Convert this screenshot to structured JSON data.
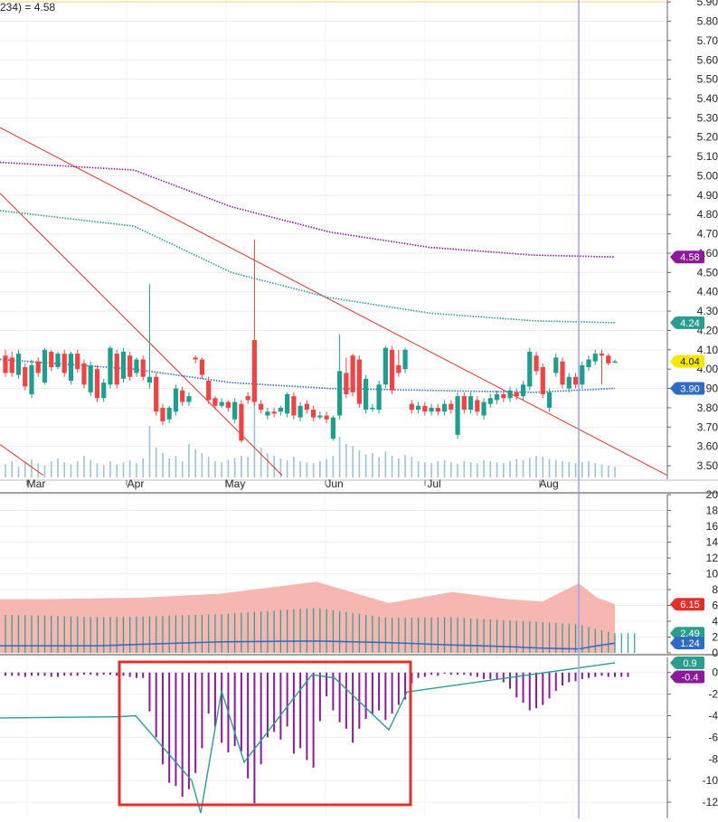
{
  "header": {
    "legend_fragment": "234) = 4.58"
  },
  "chart_data": [
    {
      "type": "candlestick",
      "title": "",
      "months": [
        "Mar",
        "Apr",
        "May",
        "Jun",
        "Jul",
        "Aug"
      ],
      "y_ticks": [
        "5.90",
        "5.80",
        "5.70",
        "5.60",
        "5.50",
        "5.40",
        "5.30",
        "5.20",
        "5.10",
        "5.00",
        "4.90",
        "4.80",
        "4.70",
        "4.60",
        "4.50",
        "4.40",
        "4.30",
        "4.20",
        "4.10",
        "4.00",
        "3.90",
        "3.80",
        "3.70",
        "3.60",
        "3.50"
      ],
      "ylim": [
        3.43,
        5.91
      ],
      "badges": [
        {
          "label": "4.58",
          "color": "#8b1a9a",
          "value": 4.58
        },
        {
          "label": "4.24",
          "color": "#2a9d8f",
          "value": 4.24
        },
        {
          "label": "4.04",
          "color": "#f5e800",
          "value": 4.04
        },
        {
          "label": "3.90",
          "color": "#2f6bc4",
          "value": 3.9
        }
      ],
      "moving_averages": [
        {
          "color": "#8b1a9a",
          "values_at_months": [
            5.07,
            5.03,
            4.84,
            4.71,
            4.63,
            4.59,
            4.58
          ]
        },
        {
          "color": "#2a9d8f",
          "values_at_months": [
            4.82,
            4.74,
            4.5,
            4.37,
            4.29,
            4.25,
            4.24
          ]
        },
        {
          "color": "#2f6bc4",
          "values_at_months": [
            4.05,
            4.0,
            3.93,
            3.9,
            3.89,
            3.88,
            3.9
          ]
        }
      ],
      "trendlines": [
        {
          "color": "#e0312b",
          "from": [
            "start",
            5.25
          ],
          "to": [
            "end",
            3.45
          ]
        },
        {
          "color": "#e0312b",
          "from": [
            "start",
            4.91
          ],
          "to": [
            "Apr-May",
            3.45
          ]
        },
        {
          "color": "#e0312b",
          "from": [
            "start",
            3.61
          ],
          "to": [
            "Mar-Apr",
            3.45
          ]
        }
      ],
      "candles": [
        {
          "o": 4.07,
          "c": 3.98,
          "h": 4.1,
          "l": 3.96
        },
        {
          "o": 4.06,
          "c": 3.98,
          "h": 4.09,
          "l": 3.96
        },
        {
          "o": 3.97,
          "c": 4.08,
          "h": 4.1,
          "l": 3.95
        },
        {
          "o": 4.01,
          "c": 3.91,
          "h": 4.03,
          "l": 3.89
        },
        {
          "o": 3.87,
          "c": 4.02,
          "h": 4.05,
          "l": 3.85
        },
        {
          "o": 4.04,
          "c": 3.98,
          "h": 4.06,
          "l": 3.96
        },
        {
          "o": 3.93,
          "c": 4.1,
          "h": 4.11,
          "l": 3.92
        },
        {
          "o": 4.09,
          "c": 4.01,
          "h": 4.1,
          "l": 3.99
        },
        {
          "o": 4.01,
          "c": 4.08,
          "h": 4.09,
          "l": 4.0
        },
        {
          "o": 4.08,
          "c": 3.98,
          "h": 4.1,
          "l": 3.96
        },
        {
          "o": 3.94,
          "c": 4.08,
          "h": 4.09,
          "l": 3.92
        },
        {
          "o": 4.08,
          "c": 4.0,
          "h": 4.1,
          "l": 3.98
        },
        {
          "o": 4.03,
          "c": 3.92,
          "h": 4.05,
          "l": 3.9
        },
        {
          "o": 3.88,
          "c": 4.02,
          "h": 4.04,
          "l": 3.86
        },
        {
          "o": 4.0,
          "c": 3.85,
          "h": 4.02,
          "l": 3.83
        },
        {
          "o": 3.85,
          "c": 3.93,
          "h": 3.95,
          "l": 3.83
        },
        {
          "o": 3.92,
          "c": 4.11,
          "h": 4.12,
          "l": 3.9
        },
        {
          "o": 4.08,
          "c": 3.92,
          "h": 4.1,
          "l": 3.9
        },
        {
          "o": 3.95,
          "c": 4.09,
          "h": 4.11,
          "l": 3.93
        },
        {
          "o": 4.07,
          "c": 3.96,
          "h": 4.09,
          "l": 3.94
        },
        {
          "o": 3.98,
          "c": 4.05,
          "h": 4.06,
          "l": 3.96
        },
        {
          "o": 4.05,
          "c": 3.96,
          "h": 4.07,
          "l": 3.94
        },
        {
          "o": 3.93,
          "c": 3.96,
          "h": 4.44,
          "l": 3.9
        },
        {
          "o": 3.96,
          "c": 3.78,
          "h": 3.98,
          "l": 3.76
        },
        {
          "o": 3.8,
          "c": 3.73,
          "h": 3.82,
          "l": 3.71
        },
        {
          "o": 3.74,
          "c": 3.8,
          "h": 3.81,
          "l": 3.72
        },
        {
          "o": 3.78,
          "c": 3.9,
          "h": 3.92,
          "l": 3.76
        },
        {
          "o": 3.89,
          "c": 3.83,
          "h": 3.91,
          "l": 3.81
        },
        {
          "o": 3.83,
          "c": 3.86,
          "h": 3.88,
          "l": 3.81
        },
        {
          "o": 4.06,
          "c": 4.05,
          "h": 4.07,
          "l": 4.03
        },
        {
          "o": 4.05,
          "c": 3.97,
          "h": 4.06,
          "l": 3.95
        },
        {
          "o": 3.94,
          "c": 3.84,
          "h": 3.96,
          "l": 3.82
        },
        {
          "o": 3.85,
          "c": 3.81,
          "h": 3.86,
          "l": 3.79
        },
        {
          "o": 3.81,
          "c": 3.83,
          "h": 3.85,
          "l": 3.8
        },
        {
          "o": 3.83,
          "c": 3.8,
          "h": 3.84,
          "l": 3.78
        },
        {
          "o": 3.74,
          "c": 3.83,
          "h": 3.85,
          "l": 3.72
        },
        {
          "o": 3.82,
          "c": 3.63,
          "h": 3.84,
          "l": 3.62
        },
        {
          "o": 3.86,
          "c": 3.84,
          "h": 3.88,
          "l": 3.82
        },
        {
          "o": 4.15,
          "c": 3.83,
          "h": 4.67,
          "l": 3.81
        },
        {
          "o": 3.82,
          "c": 3.79,
          "h": 3.84,
          "l": 3.77
        },
        {
          "o": 3.76,
          "c": 3.78,
          "h": 3.8,
          "l": 3.74
        },
        {
          "o": 3.78,
          "c": 3.77,
          "h": 3.8,
          "l": 3.75
        },
        {
          "o": 3.78,
          "c": 3.8,
          "h": 3.81,
          "l": 3.76
        },
        {
          "o": 3.77,
          "c": 3.87,
          "h": 3.88,
          "l": 3.75
        },
        {
          "o": 3.86,
          "c": 3.76,
          "h": 3.88,
          "l": 3.74
        },
        {
          "o": 3.75,
          "c": 3.81,
          "h": 3.83,
          "l": 3.73
        },
        {
          "o": 3.82,
          "c": 3.79,
          "h": 3.84,
          "l": 3.77
        },
        {
          "o": 3.79,
          "c": 3.75,
          "h": 3.81,
          "l": 3.73
        },
        {
          "o": 3.75,
          "c": 3.76,
          "h": 3.78,
          "l": 3.74
        },
        {
          "o": 3.76,
          "c": 3.74,
          "h": 3.78,
          "l": 3.72
        },
        {
          "o": 3.64,
          "c": 3.75,
          "h": 3.76,
          "l": 3.63
        },
        {
          "o": 3.76,
          "c": 3.99,
          "h": 4.18,
          "l": 3.74
        },
        {
          "o": 3.98,
          "c": 3.87,
          "h": 4.06,
          "l": 3.85
        },
        {
          "o": 4.07,
          "c": 3.88,
          "h": 4.08,
          "l": 3.86
        },
        {
          "o": 4.05,
          "c": 3.82,
          "h": 4.07,
          "l": 3.8
        },
        {
          "o": 3.79,
          "c": 3.95,
          "h": 3.97,
          "l": 3.77
        },
        {
          "o": 3.8,
          "c": 3.8,
          "h": 3.82,
          "l": 3.78
        },
        {
          "o": 3.79,
          "c": 3.92,
          "h": 3.94,
          "l": 3.77
        },
        {
          "o": 3.92,
          "c": 4.11,
          "h": 4.12,
          "l": 3.9
        },
        {
          "o": 4.1,
          "c": 3.89,
          "h": 4.12,
          "l": 3.87
        },
        {
          "o": 4.02,
          "c": 3.98,
          "h": 4.1,
          "l": 3.96
        },
        {
          "o": 4.0,
          "c": 4.1,
          "h": 4.11,
          "l": 3.98
        },
        {
          "o": 3.82,
          "c": 3.79,
          "h": 3.84,
          "l": 3.77
        },
        {
          "o": 3.79,
          "c": 3.81,
          "h": 3.83,
          "l": 3.77
        },
        {
          "o": 3.81,
          "c": 3.78,
          "h": 3.83,
          "l": 3.76
        },
        {
          "o": 3.78,
          "c": 3.8,
          "h": 3.82,
          "l": 3.76
        },
        {
          "o": 3.8,
          "c": 3.78,
          "h": 3.82,
          "l": 3.76
        },
        {
          "o": 3.78,
          "c": 3.82,
          "h": 3.84,
          "l": 3.76
        },
        {
          "o": 3.82,
          "c": 3.79,
          "h": 3.84,
          "l": 3.77
        },
        {
          "o": 3.66,
          "c": 3.86,
          "h": 3.88,
          "l": 3.64
        },
        {
          "o": 3.86,
          "c": 3.79,
          "h": 3.88,
          "l": 3.77
        },
        {
          "o": 3.79,
          "c": 3.86,
          "h": 3.88,
          "l": 3.77
        },
        {
          "o": 3.84,
          "c": 3.78,
          "h": 3.86,
          "l": 3.76
        },
        {
          "o": 3.76,
          "c": 3.83,
          "h": 3.85,
          "l": 3.74
        },
        {
          "o": 3.82,
          "c": 3.85,
          "h": 3.87,
          "l": 3.8
        },
        {
          "o": 3.84,
          "c": 3.87,
          "h": 3.89,
          "l": 3.82
        },
        {
          "o": 3.87,
          "c": 3.85,
          "h": 3.89,
          "l": 3.83
        },
        {
          "o": 3.85,
          "c": 3.89,
          "h": 3.91,
          "l": 3.83
        },
        {
          "o": 3.88,
          "c": 3.86,
          "h": 3.9,
          "l": 3.84
        },
        {
          "o": 3.86,
          "c": 3.92,
          "h": 3.94,
          "l": 3.84
        },
        {
          "o": 3.91,
          "c": 4.09,
          "h": 4.11,
          "l": 3.89
        },
        {
          "o": 4.07,
          "c": 3.99,
          "h": 4.09,
          "l": 3.97
        },
        {
          "o": 4.01,
          "c": 3.87,
          "h": 4.03,
          "l": 3.85
        },
        {
          "o": 3.8,
          "c": 3.88,
          "h": 3.9,
          "l": 3.78
        },
        {
          "o": 3.98,
          "c": 4.06,
          "h": 4.08,
          "l": 3.96
        },
        {
          "o": 4.04,
          "c": 3.92,
          "h": 4.06,
          "l": 3.9
        },
        {
          "o": 3.9,
          "c": 3.96,
          "h": 3.98,
          "l": 3.88
        },
        {
          "o": 3.96,
          "c": 3.92,
          "h": 3.98,
          "l": 3.9
        },
        {
          "o": 3.92,
          "c": 4.02,
          "h": 4.04,
          "l": 3.9
        },
        {
          "o": 4.01,
          "c": 4.05,
          "h": 4.07,
          "l": 3.99
        },
        {
          "o": 4.04,
          "c": 4.08,
          "h": 4.1,
          "l": 4.02
        },
        {
          "o": 4.08,
          "c": 4.07,
          "h": 4.1,
          "l": 3.92
        },
        {
          "o": 4.07,
          "c": 4.03,
          "h": 4.08,
          "l": 4.02
        },
        {
          "o": 4.04,
          "c": 4.04,
          "h": 4.05,
          "l": 4.03
        }
      ],
      "volume": [
        0.25,
        0.3,
        0.2,
        0.28,
        0.33,
        0.26,
        0.22,
        0.3,
        0.35,
        0.28,
        0.24,
        0.3,
        0.4,
        0.32,
        0.26,
        0.22,
        0.3,
        0.24,
        0.28,
        0.32,
        0.26,
        0.35,
        0.95,
        0.55,
        0.45,
        0.35,
        0.4,
        0.3,
        0.62,
        0.52,
        0.45,
        0.38,
        0.3,
        0.28,
        0.32,
        0.36,
        0.4,
        0.38,
        1.6,
        0.55,
        0.45,
        0.4,
        0.35,
        0.32,
        0.38,
        0.3,
        0.28,
        0.26,
        0.3,
        0.34,
        0.4,
        0.75,
        0.62,
        0.58,
        0.5,
        0.42,
        0.45,
        0.38,
        0.48,
        0.4,
        0.35,
        0.42,
        0.38,
        0.3,
        0.28,
        0.26,
        0.3,
        0.32,
        0.28,
        0.25,
        0.3,
        0.28,
        0.26,
        0.32,
        0.3,
        0.28,
        0.26,
        0.3,
        0.34,
        0.32,
        0.36,
        0.4,
        0.38,
        0.34,
        0.32,
        0.3,
        0.28,
        0.26,
        0.28,
        0.3,
        0.26,
        0.24,
        0.22,
        0.2,
        0.18,
        0.15,
        0.1
      ]
    },
    {
      "type": "area",
      "y_ticks": [
        "20",
        "18",
        "16",
        "14",
        "12",
        "10",
        "8",
        "6",
        "4",
        "2",
        "0"
      ],
      "ylim": [
        0,
        20
      ],
      "badges": [
        {
          "label": "6.15",
          "color": "#e0312b",
          "value": 6.15
        },
        {
          "label": "2.49",
          "color": "#2a9d8f",
          "value": 2.49
        },
        {
          "label": "1.24",
          "color": "#2f6bc4",
          "value": 1.24
        }
      ],
      "series": [
        {
          "color": "#f4a9a5",
          "values_at_months": [
            6.8,
            6.8,
            6.9,
            7.0,
            7.5,
            9.0,
            6.3,
            7.7,
            6.8,
            6.5,
            8.8,
            7.0,
            6.15
          ]
        },
        {
          "color": "#2a9d8f",
          "values_at_months": [
            4.8,
            4.7,
            4.5,
            4.6,
            4.9,
            5.7,
            4.4,
            4.5,
            4.1,
            3.9,
            3.6,
            3.0,
            2.49
          ]
        },
        {
          "color": "#2f6bc4",
          "values_at_months": [
            0.9,
            0.9,
            0.9,
            1.1,
            1.4,
            1.5,
            1.3,
            1.0,
            0.8,
            0.6,
            0.5,
            0.9,
            1.24
          ]
        }
      ]
    },
    {
      "type": "histogram",
      "y_ticks": [
        "0",
        "-2",
        "-4",
        "-6",
        "-8",
        "-10",
        "-12"
      ],
      "ylim": [
        -13.5,
        1.4
      ],
      "badges": [
        {
          "label": "0.9",
          "color": "#2a9d8f",
          "value": 0.9
        },
        {
          "label": "-0.4",
          "color": "#8b1a9a",
          "value": -0.4
        }
      ],
      "histogram": [
        -0.3,
        -0.3,
        -0.3,
        -0.4,
        -0.3,
        -0.3,
        -0.3,
        -0.4,
        -0.4,
        -0.3,
        -0.3,
        -0.3,
        -0.2,
        -0.2,
        -0.3,
        -0.2,
        -0.2,
        -0.3,
        -0.3,
        -0.4,
        -0.5,
        -0.5,
        -3.6,
        -6.0,
        -8.5,
        -10.2,
        -10.5,
        -11.5,
        -10.8,
        -9.3,
        -7.0,
        -3.8,
        -5.0,
        -6.5,
        -7.4,
        -6.8,
        -7.3,
        -9.8,
        -12.1,
        -8.5,
        -6.0,
        -5.5,
        -6.2,
        -5.0,
        -7.5,
        -7.0,
        -8.1,
        -8.8,
        -4.5,
        -2.2,
        -3.5,
        -4.6,
        -5.2,
        -6.5,
        -5.2,
        -4.3,
        -3.8,
        -3.5,
        -4.4,
        -3.8,
        -3.0,
        -2.5,
        -1.0,
        -0.5,
        -0.4,
        -0.2,
        -0.3,
        -0.1,
        -0.2,
        -0.2,
        -0.2,
        -0.3,
        -0.4,
        -0.6,
        -0.6,
        -0.7,
        -0.9,
        -1.5,
        -2.3,
        -2.8,
        -3.5,
        -3.3,
        -3.0,
        -2.4,
        -1.7,
        -1.2,
        -0.9,
        -0.8,
        -0.6,
        -0.5,
        -0.4,
        -0.3,
        -0.4,
        -0.4,
        -0.4,
        -0.4
      ],
      "signal_line": {
        "color": "#2a9d8f",
        "values_at_months": [
          -4.2,
          -4.1,
          -4.0,
          -10.0,
          -13.0,
          -1.7,
          -8.3,
          -0.2,
          -0.5,
          -5.3,
          -1.8,
          0.9
        ]
      }
    }
  ],
  "highlight": {
    "color": "#e0312b"
  },
  "cursor_line": {
    "color": "#9aa0f5"
  }
}
